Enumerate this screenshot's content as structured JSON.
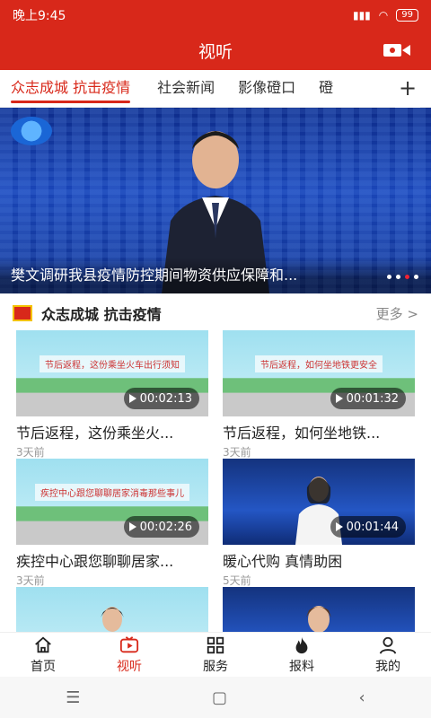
{
  "status_bar": {
    "time": "晚上9:45",
    "battery": "99"
  },
  "header": {
    "title": "视听"
  },
  "tabs": [
    {
      "label": "众志成城 抗击疫情",
      "active": true
    },
    {
      "label": "社会新闻",
      "active": false
    },
    {
      "label": "影像磴口",
      "active": false
    },
    {
      "label": "磴",
      "active": false
    }
  ],
  "hero": {
    "caption": "樊文调研我县疫情防控期间物资供应保障和...",
    "dots": 4,
    "active_dot": 3
  },
  "section": {
    "title": "众志成城 抗击疫情",
    "more": "更多 >"
  },
  "cards": [
    {
      "title": "节后返程，这份乘坐火...",
      "time": "3天前",
      "duration": "00:02:13",
      "style": "sky",
      "banner": "节后返程，这份乘坐火车出行须知"
    },
    {
      "title": "节后返程，如何坐地铁...",
      "time": "3天前",
      "duration": "00:01:32",
      "style": "sky",
      "banner": "节后返程，如何坐地铁更安全"
    },
    {
      "title": "疾控中心跟您聊聊居家...",
      "time": "3天前",
      "duration": "00:02:26",
      "style": "sky",
      "banner": "疾控中心跟您聊聊居家消毒那些事儿"
    },
    {
      "title": "暖心代购 真情助困",
      "time": "5天前",
      "duration": "00:01:44",
      "style": "news",
      "banner": ""
    },
    {
      "title": "",
      "time": "",
      "duration": "",
      "style": "sky",
      "banner": ""
    },
    {
      "title": "",
      "time": "",
      "duration": "",
      "style": "news",
      "banner": ""
    }
  ],
  "bottom_nav": [
    {
      "label": "首页",
      "icon": "home-icon",
      "active": false
    },
    {
      "label": "视听",
      "icon": "video-icon",
      "active": true
    },
    {
      "label": "服务",
      "icon": "grid-icon",
      "active": false
    },
    {
      "label": "报料",
      "icon": "fire-icon",
      "active": false
    },
    {
      "label": "我的",
      "icon": "user-icon",
      "active": false
    }
  ],
  "colors": {
    "brand": "#d8281a",
    "text": "#222222",
    "muted": "#999999"
  }
}
